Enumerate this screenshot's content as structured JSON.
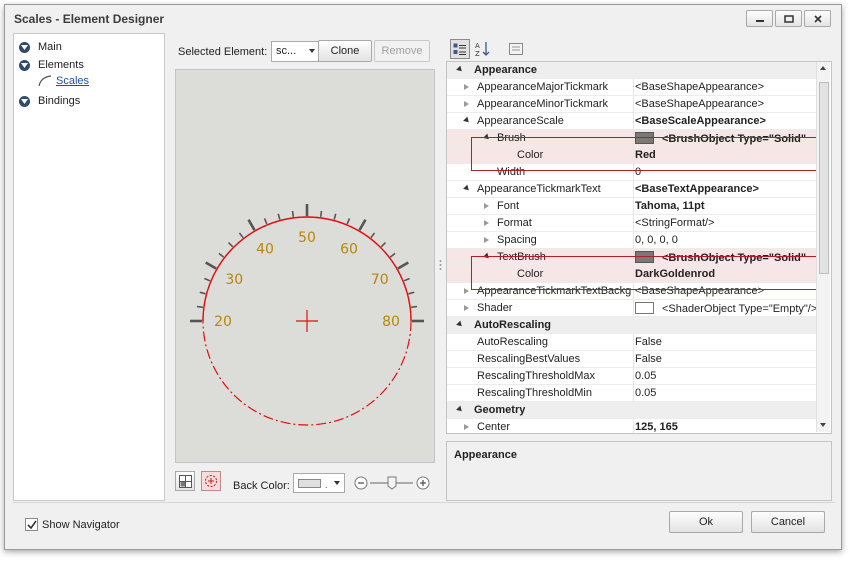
{
  "window": {
    "title": "Scales - Element Designer"
  },
  "navigator": {
    "items": [
      {
        "label": "Main"
      },
      {
        "label": "Elements"
      },
      {
        "label": "Bindings"
      }
    ],
    "sub_item": "Scales"
  },
  "toolbar": {
    "selected_label": "Selected Element:",
    "selected_value": "sc...",
    "clone_label": "Clone",
    "remove_label": "Remove"
  },
  "gauge": {
    "scale_labels": [
      "20",
      "30",
      "40",
      "50",
      "60",
      "70",
      "80"
    ],
    "range_min": 20,
    "range_max": 80,
    "label_color": "#b8860b",
    "scale_color": "#e01010",
    "tick_color": "#555555"
  },
  "canvas_tools": {
    "back_color_label": "Back Color:",
    "back_color_dots": "."
  },
  "property_grid": {
    "rows": [
      {
        "type": "cat",
        "name": "Appearance"
      },
      {
        "type": "prop",
        "indent": 0,
        "expander": "closed",
        "name": "AppearanceMajorTickmark",
        "value": "<BaseShapeAppearance>"
      },
      {
        "type": "prop",
        "indent": 0,
        "expander": "closed",
        "name": "AppearanceMinorTickmark",
        "value": "<BaseShapeAppearance>"
      },
      {
        "type": "prop",
        "indent": 0,
        "expander": "open",
        "name": "AppearanceScale",
        "value": "<BaseScaleAppearance>",
        "bold": true
      },
      {
        "type": "prop",
        "indent": 1,
        "expander": "open",
        "name": "Brush",
        "value": "<BrushObject Type=\"Solid\"",
        "bold": true,
        "swatch": "#7d7777",
        "hl": true
      },
      {
        "type": "prop",
        "indent": 2,
        "expander": "none",
        "name": "Color",
        "value": "Red",
        "bold": true,
        "hl": true
      },
      {
        "type": "prop",
        "indent": 1,
        "expander": "none",
        "name": "Width",
        "value": "0"
      },
      {
        "type": "prop",
        "indent": 0,
        "expander": "open",
        "name": "AppearanceTickmarkText",
        "value": "<BaseTextAppearance>",
        "bold": true
      },
      {
        "type": "prop",
        "indent": 1,
        "expander": "closed",
        "name": "Font",
        "value": "Tahoma, 11pt",
        "bold": true
      },
      {
        "type": "prop",
        "indent": 1,
        "expander": "closed",
        "name": "Format",
        "value": "<StringFormat/>"
      },
      {
        "type": "prop",
        "indent": 1,
        "expander": "closed",
        "name": "Spacing",
        "value": "0, 0, 0, 0"
      },
      {
        "type": "prop",
        "indent": 1,
        "expander": "open",
        "name": "TextBrush",
        "value": "<BrushObject Type=\"Solid\"",
        "bold": true,
        "swatch": "#7d7777",
        "hl": true
      },
      {
        "type": "prop",
        "indent": 2,
        "expander": "none",
        "name": "Color",
        "value": "DarkGoldenrod",
        "bold": true,
        "hl": true
      },
      {
        "type": "prop",
        "indent": 0,
        "expander": "closed",
        "name": "AppearanceTickmarkTextBackgro",
        "value": "<BaseShapeAppearance>"
      },
      {
        "type": "prop",
        "indent": 0,
        "expander": "closed",
        "name": "Shader",
        "value": "<ShaderObject Type=\"Empty\"/>",
        "swatch": "#ffffff"
      },
      {
        "type": "cat",
        "name": "AutoRescaling"
      },
      {
        "type": "prop",
        "indent": 0,
        "expander": "none",
        "name": "AutoRescaling",
        "value": "False"
      },
      {
        "type": "prop",
        "indent": 0,
        "expander": "none",
        "name": "RescalingBestValues",
        "value": "False"
      },
      {
        "type": "prop",
        "indent": 0,
        "expander": "none",
        "name": "RescalingThresholdMax",
        "value": "0.05"
      },
      {
        "type": "prop",
        "indent": 0,
        "expander": "none",
        "name": "RescalingThresholdMin",
        "value": "0.05"
      },
      {
        "type": "cat",
        "name": "Geometry"
      },
      {
        "type": "prop",
        "indent": 0,
        "expander": "closed",
        "name": "Center",
        "value": "125, 165",
        "bold": true
      }
    ]
  },
  "description": {
    "title": "Appearance"
  },
  "footer": {
    "show_navigator_label": "Show Navigator",
    "show_navigator_checked": true,
    "ok_label": "Ok",
    "cancel_label": "Cancel"
  }
}
